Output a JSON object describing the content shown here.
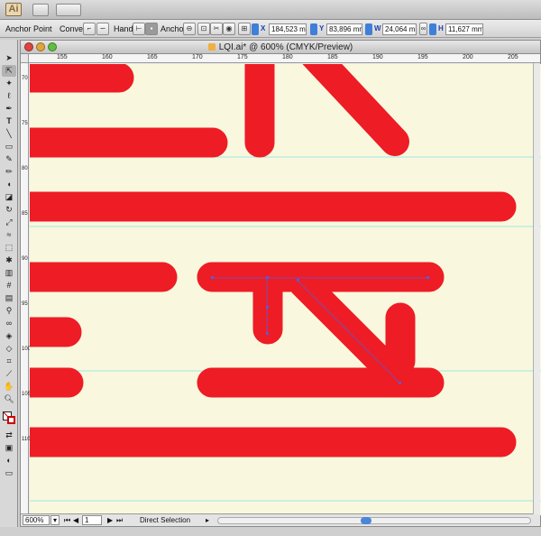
{
  "app": {
    "logo": "Ai"
  },
  "control": {
    "mode_label": "Anchor Point",
    "convert_label": "Convert:",
    "handles_label": "Handles:",
    "anchors_label": "Anchors:",
    "x_label": "X",
    "x_value": "184,523 mm",
    "y_label": "Y",
    "y_value": "83,896 mm",
    "w_label": "W",
    "w_value": "24,064 mm",
    "h_label": "H",
    "h_value": "11,627 mm"
  },
  "document": {
    "title": "LQI.ai* @ 600% (CMYK/Preview)",
    "ruler_h": [
      "155",
      "160",
      "165",
      "170",
      "175",
      "180",
      "185",
      "190",
      "195",
      "200",
      "205"
    ],
    "ruler_v": [
      "70",
      "75",
      "80",
      "85",
      "90",
      "95",
      "100",
      "105",
      "110"
    ],
    "zoom": "600%",
    "page": "1",
    "status": "Direct Selection"
  },
  "colors": {
    "artwork": "#ee1c25",
    "pasteboard": "#f9f8de",
    "guide": "#7fe0e6",
    "path": "#5b5bd6"
  },
  "tools": [
    "selection",
    "direct-selection",
    "magic-wand",
    "lasso",
    "pen",
    "type",
    "line",
    "rectangle",
    "paintbrush",
    "pencil",
    "blob-brush",
    "eraser",
    "rotate",
    "scale",
    "warp",
    "free-transform",
    "symbol-sprayer",
    "column-graph",
    "mesh",
    "gradient",
    "eyedropper",
    "blend",
    "live-paint",
    "live-paint-select",
    "crop",
    "slice",
    "hand",
    "zoom"
  ]
}
